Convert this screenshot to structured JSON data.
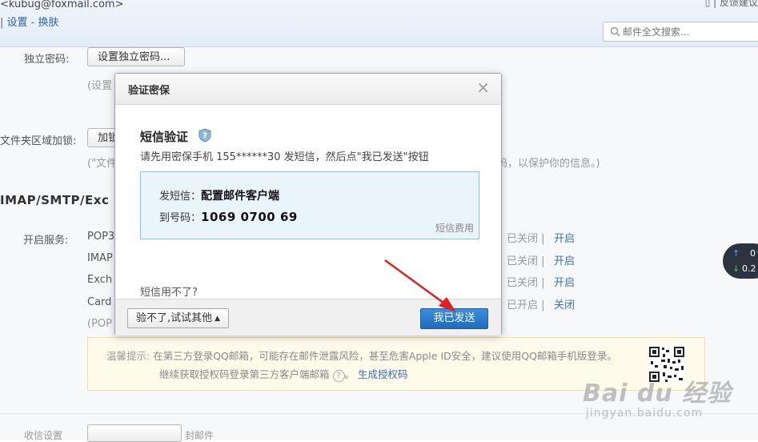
{
  "header": {
    "account": "<kubug@foxmail.com>",
    "settings_link": "设置",
    "skin_link": "换肤",
    "feedback_link": "反馈建议",
    "search_placeholder": "邮件全文搜索..."
  },
  "background": {
    "independent_password_label": "独立密码:",
    "independent_password_button": "设置独立密码...",
    "independent_password_note": "(设置",
    "folder_lock_label": "文件夹区域加锁:",
    "folder_lock_button": "加锁",
    "folder_lock_note_left": "(\"文件",
    "folder_lock_note_right": "码，以保护你的信息。)",
    "section_title": "IMAP/SMTP/Exc",
    "service_label": "开启服务:",
    "services": [
      {
        "name": "POP3",
        "status": "已关闭 |",
        "action": "开启"
      },
      {
        "name": "IMAP",
        "status": "已关闭 |",
        "action": "开启"
      },
      {
        "name": "Exch",
        "status": "已关闭 |",
        "action": "开启"
      },
      {
        "name": "Card",
        "status": "已开启 |",
        "action": "关闭"
      }
    ],
    "pop_note": "(POP",
    "tip": {
      "label": "温馨提示:",
      "line1": "在第三方登录QQ邮箱，可能存在邮件泄露风险，甚至危害Apple ID安全，建议使用QQ邮箱手机版登录。",
      "line2": "继续获取授权码登录第三方客户端邮箱",
      "help_icon": "?",
      "link": "生成授权码"
    },
    "bottom_left": "收信设置",
    "bottom_right": "封邮件"
  },
  "speed_widget": {
    "up": "0↑",
    "down": "0.2↓"
  },
  "dialog": {
    "title": "验证密保",
    "close": "×",
    "sms_title": "短信验证",
    "instruction": "请先用密保手机 155******30 发短信，然后点\"我已发送\"按钮",
    "send_label": "发短信：",
    "send_content": "配置邮件客户端",
    "to_label": "到号码：",
    "to_number": "1069 0700 69",
    "fee_link": "短信费用",
    "unavailable": "短信用不了?",
    "other_button": "验不了,试试其他",
    "sent_button": "我已发送"
  },
  "watermark": {
    "main": "Bai du 经验",
    "sub": "jingyan.baidu.com"
  },
  "colors": {
    "primary_button": "#2a7bd1",
    "link": "#3a6fb5",
    "annotation_arrow": "#e02020"
  }
}
